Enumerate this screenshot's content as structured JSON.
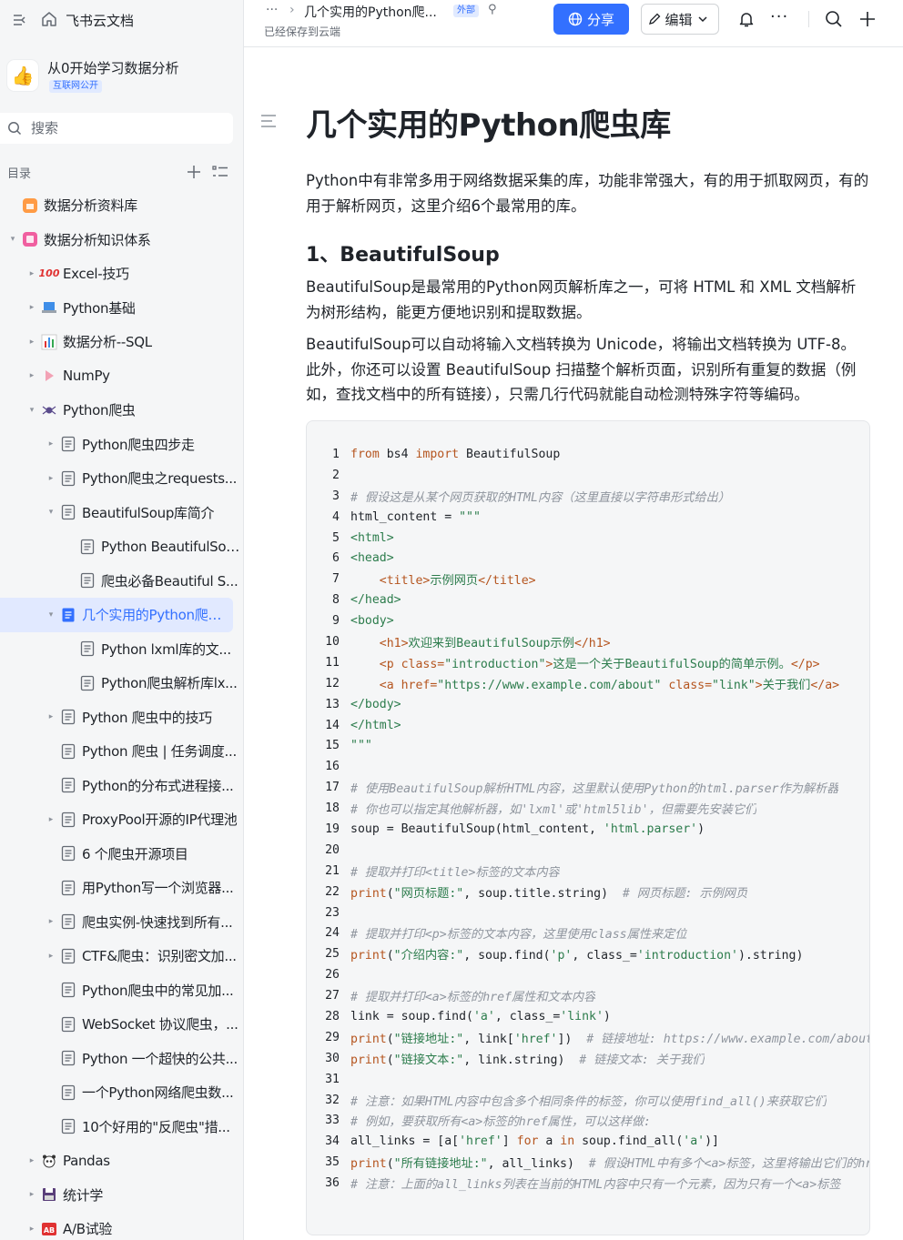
{
  "sidebar": {
    "brand": "飞书云文档",
    "space_name": "从0开始学习数据分析",
    "space_badge": "互联网公开",
    "search_placeholder": "搜索",
    "toc_label": "目录",
    "items": [
      {
        "label": "数据分析资料库",
        "level": 0,
        "arrow": "",
        "icon": "orange-folder-icon"
      },
      {
        "label": "数据分析知识体系",
        "level": 0,
        "arrow": "▾",
        "icon": "pink-folder-icon"
      },
      {
        "label": "Excel-技巧",
        "level": 1,
        "arrow": "▸",
        "icon": "hundred-points-emoji-icon"
      },
      {
        "label": "Python基础",
        "level": 1,
        "arrow": "▸",
        "icon": "laptop-emoji-icon"
      },
      {
        "label": "数据分析--SQL",
        "level": 1,
        "arrow": "▸",
        "icon": "bar-chart-emoji-icon"
      },
      {
        "label": "NumPy",
        "level": 1,
        "arrow": "▸",
        "icon": "triangle-emoji-icon"
      },
      {
        "label": "Python爬虫",
        "level": 1,
        "arrow": "▾",
        "icon": "spider-emoji-icon"
      },
      {
        "label": "Python爬虫四步走",
        "level": 2,
        "arrow": "▸",
        "icon": "doc-icon"
      },
      {
        "label": "Python爬虫之requests...",
        "level": 2,
        "arrow": "▸",
        "icon": "doc-icon"
      },
      {
        "label": "BeautifulSoup库简介",
        "level": 2,
        "arrow": "▾",
        "icon": "doc-icon"
      },
      {
        "label": "Python BeautifulSou...",
        "level": 3,
        "arrow": "",
        "icon": "doc-icon"
      },
      {
        "label": "爬虫必备Beautiful S...",
        "level": 3,
        "arrow": "",
        "icon": "doc-icon"
      },
      {
        "label": "几个实用的Python爬虫库",
        "level": 2,
        "arrow": "▾",
        "icon": "doc-icon-active",
        "active": true
      },
      {
        "label": "Python lxml库的文...",
        "level": 3,
        "arrow": "",
        "icon": "doc-icon"
      },
      {
        "label": "Python爬虫解析库lx...",
        "level": 3,
        "arrow": "",
        "icon": "doc-icon"
      },
      {
        "label": "Python 爬虫中的技巧",
        "level": 2,
        "arrow": "▸",
        "icon": "doc-icon"
      },
      {
        "label": "Python 爬虫 | 任务调度...",
        "level": 2,
        "arrow": "",
        "icon": "doc-icon"
      },
      {
        "label": "Python的分布式进程接...",
        "level": 2,
        "arrow": "",
        "icon": "doc-icon"
      },
      {
        "label": "ProxyPool开源的IP代理池",
        "level": 2,
        "arrow": "▸",
        "icon": "doc-icon"
      },
      {
        "label": "6 个爬虫开源项目",
        "level": 2,
        "arrow": "",
        "icon": "doc-icon"
      },
      {
        "label": "用Python写一个浏览器...",
        "level": 2,
        "arrow": "",
        "icon": "doc-icon"
      },
      {
        "label": "爬虫实例-快速找到所有...",
        "level": 2,
        "arrow": "▸",
        "icon": "doc-icon"
      },
      {
        "label": "CTF&爬虫：识别密文加...",
        "level": 2,
        "arrow": "▸",
        "icon": "doc-icon"
      },
      {
        "label": "Python爬虫中的常见加...",
        "level": 2,
        "arrow": "",
        "icon": "doc-icon"
      },
      {
        "label": "WebSocket 协议爬虫，...",
        "level": 2,
        "arrow": "",
        "icon": "doc-icon"
      },
      {
        "label": "Python 一个超快的公共...",
        "level": 2,
        "arrow": "",
        "icon": "doc-icon"
      },
      {
        "label": "一个Python网络爬虫数...",
        "level": 2,
        "arrow": "",
        "icon": "doc-icon"
      },
      {
        "label": "10个好用的\"反爬虫\"措...",
        "level": 2,
        "arrow": "",
        "icon": "doc-icon"
      },
      {
        "label": "Pandas",
        "level": 1,
        "arrow": "▸",
        "icon": "panda-emoji-icon"
      },
      {
        "label": "统计学",
        "level": 1,
        "arrow": "▸",
        "icon": "floppy-emoji-icon"
      },
      {
        "label": "A/B试验",
        "level": 1,
        "arrow": "▸",
        "icon": "ab-emoji-icon"
      }
    ]
  },
  "topbar": {
    "more": "···",
    "sep": "›",
    "title": "几个实用的Python爬...",
    "external_badge": "外部",
    "pin": "⚲",
    "saved": "已经保存到云端",
    "share_label": "分享",
    "edit_label": "编辑",
    "dots": "···"
  },
  "doc": {
    "title": "几个实用的Python爬虫库",
    "intro": "Python中有非常多用于网络数据采集的库，功能非常强大，有的用于抓取网页，有的用于解析网页，这里介绍6个最常用的库。",
    "h2": "1、BeautifulSoup",
    "p1": "BeautifulSoup是最常用的Python网页解析库之一，可将 HTML 和 XML 文档解析为树形结构，能更方便地识别和提取数据。",
    "p2": "BeautifulSoup可以自动将输入文档转换为 Unicode，将输出文档转换为 UTF-8。此外，你还可以设置 BeautifulSoup 扫描整个解析页面，识别所有重复的数据（例如，查找文档中的所有链接），只需几行代码就能自动检测特殊字符等编码。",
    "code_lines": [
      [
        [
          "k",
          "from"
        ],
        [
          "n",
          " bs4 "
        ],
        [
          "k",
          "import"
        ],
        [
          "n",
          " BeautifulSoup"
        ]
      ],
      [],
      [
        [
          "c",
          "# 假设这是从某个网页获取的HTML内容（这里直接以字符串形式给出）"
        ]
      ],
      [
        [
          "n",
          "html_content = "
        ],
        [
          "s",
          "\"\"\""
        ]
      ],
      [
        [
          "g",
          "<html>"
        ]
      ],
      [
        [
          "g",
          "<head>"
        ]
      ],
      [
        [
          "n",
          "    "
        ],
        [
          "f",
          "<title>"
        ],
        [
          "g",
          "示例网页"
        ],
        [
          "f",
          "</title>"
        ]
      ],
      [
        [
          "g",
          "</head>"
        ]
      ],
      [
        [
          "g",
          "<body>"
        ]
      ],
      [
        [
          "n",
          "    "
        ],
        [
          "f",
          "<h1>"
        ],
        [
          "g",
          "欢迎来到BeautifulSoup示例"
        ],
        [
          "f",
          "</h1>"
        ]
      ],
      [
        [
          "n",
          "    "
        ],
        [
          "f",
          "<p class="
        ],
        [
          "g",
          "\"introduction\""
        ],
        [
          "f",
          ">"
        ],
        [
          "g",
          "这是一个关于BeautifulSoup的简单示例。"
        ],
        [
          "f",
          "</p>"
        ]
      ],
      [
        [
          "n",
          "    "
        ],
        [
          "f",
          "<a href="
        ],
        [
          "g",
          "\"https://www.example.com/about\""
        ],
        [
          "f",
          " class="
        ],
        [
          "g",
          "\"link\""
        ],
        [
          "f",
          ">"
        ],
        [
          "g",
          "关于我们"
        ],
        [
          "f",
          "</a>"
        ]
      ],
      [
        [
          "g",
          "</body>"
        ]
      ],
      [
        [
          "g",
          "</html>"
        ]
      ],
      [
        [
          "s",
          "\"\"\""
        ]
      ],
      [],
      [
        [
          "c",
          "# 使用BeautifulSoup解析HTML内容，这里默认使用Python的html.parser作为解析器"
        ]
      ],
      [
        [
          "c",
          "# 你也可以指定其他解析器，如'lxml'或'html5lib'，但需要先安装它们"
        ]
      ],
      [
        [
          "n",
          "soup = BeautifulSoup(html_content, "
        ],
        [
          "s",
          "'html.parser'"
        ],
        [
          "n",
          ")"
        ]
      ],
      [],
      [
        [
          "c",
          "# 提取并打印<title>标签的文本内容"
        ]
      ],
      [
        [
          "k",
          "print"
        ],
        [
          "n",
          "("
        ],
        [
          "s",
          "\"网页标题:\""
        ],
        [
          "n",
          ", soup.title.string)  "
        ],
        [
          "c",
          "# 网页标题: 示例网页"
        ]
      ],
      [],
      [
        [
          "c",
          "# 提取并打印<p>标签的文本内容，这里使用class属性来定位"
        ]
      ],
      [
        [
          "k",
          "print"
        ],
        [
          "n",
          "("
        ],
        [
          "s",
          "\"介绍内容:\""
        ],
        [
          "n",
          ", soup.find("
        ],
        [
          "s",
          "'p'"
        ],
        [
          "n",
          ", class_="
        ],
        [
          "s",
          "'introduction'"
        ],
        [
          "n",
          ").string)"
        ]
      ],
      [],
      [
        [
          "c",
          "# 提取并打印<a>标签的href属性和文本内容"
        ]
      ],
      [
        [
          "n",
          "link = soup.find("
        ],
        [
          "s",
          "'a'"
        ],
        [
          "n",
          ", class_="
        ],
        [
          "s",
          "'link'"
        ],
        [
          "n",
          ")"
        ]
      ],
      [
        [
          "k",
          "print"
        ],
        [
          "n",
          "("
        ],
        [
          "s",
          "\"链接地址:\""
        ],
        [
          "n",
          ", link["
        ],
        [
          "s",
          "'href'"
        ],
        [
          "n",
          "])  "
        ],
        [
          "c",
          "# 链接地址: https://www.example.com/about"
        ]
      ],
      [
        [
          "k",
          "print"
        ],
        [
          "n",
          "("
        ],
        [
          "s",
          "\"链接文本:\""
        ],
        [
          "n",
          ", link.string)  "
        ],
        [
          "c",
          "# 链接文本: 关于我们"
        ]
      ],
      [],
      [
        [
          "c",
          "# 注意：如果HTML内容中包含多个相同条件的标签，你可以使用find_all()来获取它们"
        ]
      ],
      [
        [
          "c",
          "# 例如，要获取所有<a>标签的href属性，可以这样做:"
        ]
      ],
      [
        [
          "n",
          "all_links = [a["
        ],
        [
          "s",
          "'href'"
        ],
        [
          "n",
          "] "
        ],
        [
          "k",
          "for"
        ],
        [
          "n",
          " a "
        ],
        [
          "k",
          "in"
        ],
        [
          "n",
          " soup.find_all("
        ],
        [
          "s",
          "'a'"
        ],
        [
          "n",
          ")]"
        ]
      ],
      [
        [
          "k",
          "print"
        ],
        [
          "n",
          "("
        ],
        [
          "s",
          "\"所有链接地址:\""
        ],
        [
          "n",
          ", all_links)  "
        ],
        [
          "c",
          "# 假设HTML中有多个<a>标签，这里将输出它们的href属性"
        ]
      ],
      [
        [
          "c",
          "# 注意：上面的all_links列表在当前的HTML内容中只有一个元素，因为只有一个<a>标签"
        ]
      ]
    ]
  }
}
